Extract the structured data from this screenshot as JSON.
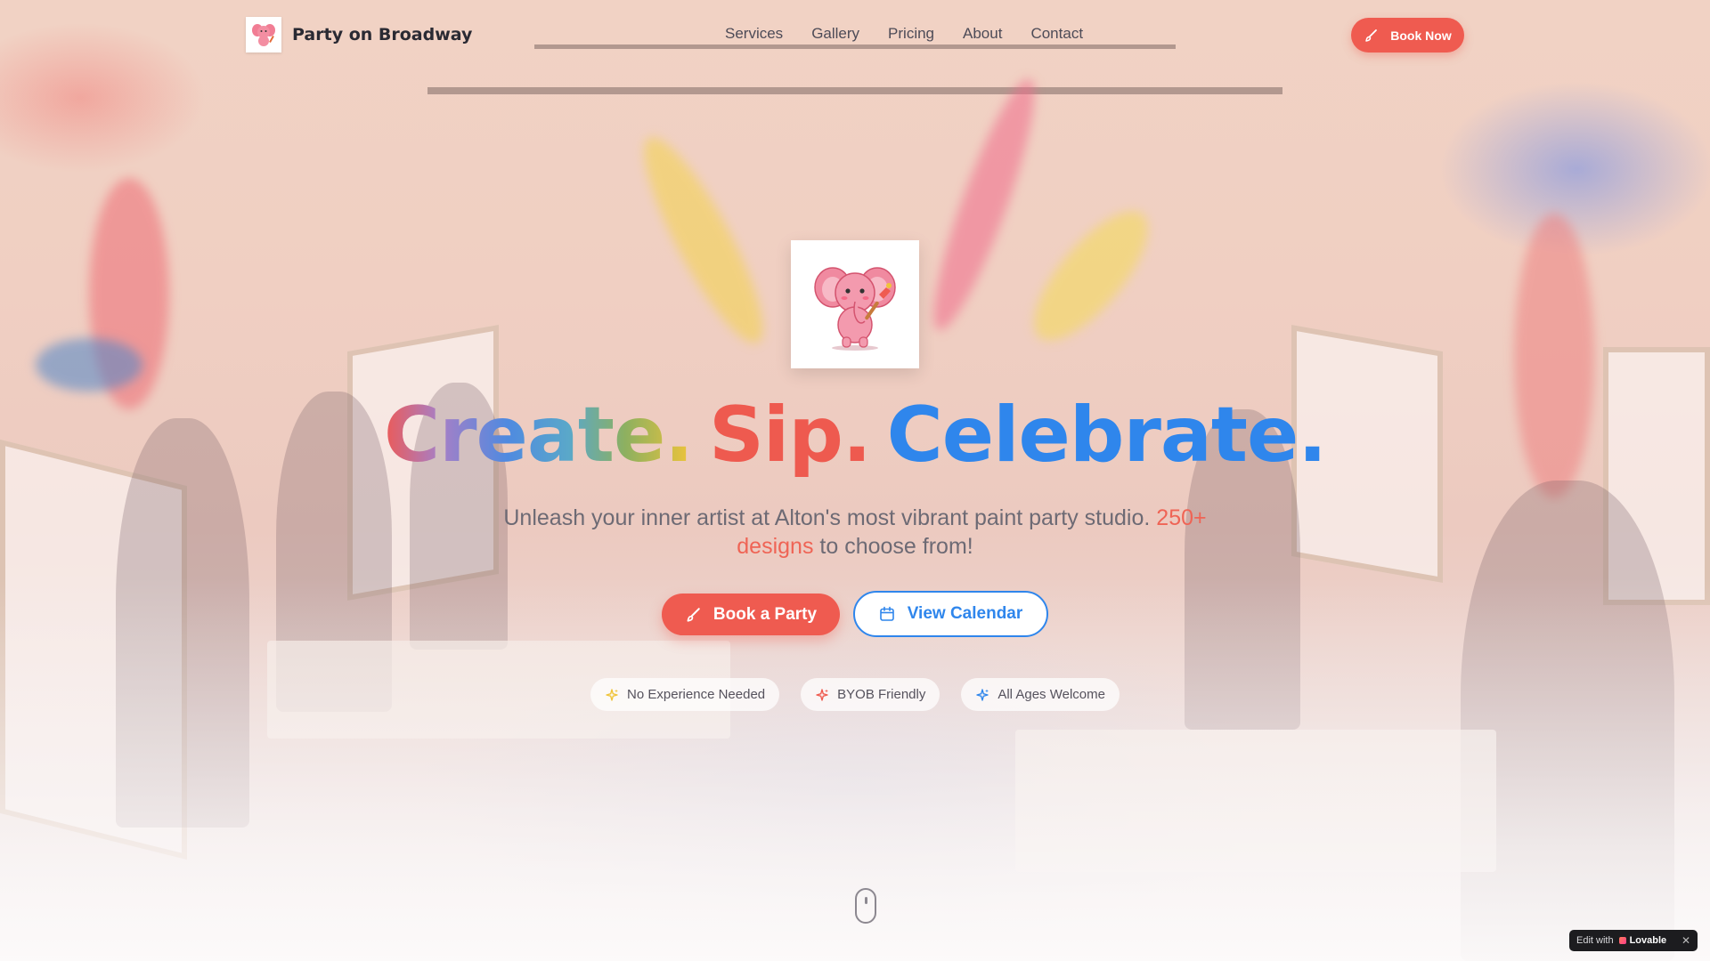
{
  "brand": {
    "name": "Party on Broadway",
    "logo_icon": "pink-elephant-painter-icon"
  },
  "nav": {
    "items": [
      {
        "label": "Services"
      },
      {
        "label": "Gallery"
      },
      {
        "label": "Pricing"
      },
      {
        "label": "About"
      },
      {
        "label": "Contact"
      }
    ]
  },
  "header": {
    "cta_label": "Book Now",
    "cta_icon": "paintbrush-icon"
  },
  "hero": {
    "headline": {
      "word1": "Create.",
      "word2": "Sip.",
      "word3": "Celebrate."
    },
    "subtitle": {
      "lead": "Unleash your inner artist at Alton's most vibrant paint party studio.",
      "accent": "250+ designs",
      "tail": "to choose from!"
    },
    "primary_cta": "Book a Party",
    "secondary_cta": "View Calendar",
    "badges": [
      {
        "label": "No Experience Needed",
        "icon": "sparkles-icon",
        "color": "#f0c43a"
      },
      {
        "label": "BYOB Friendly",
        "icon": "sparkles-icon",
        "color": "#ef5b50"
      },
      {
        "label": "All Ages Welcome",
        "icon": "sparkles-icon",
        "color": "#2f86ec"
      }
    ]
  },
  "footer_widget": {
    "prefix": "Edit with",
    "brand": "Lovable"
  },
  "colors": {
    "primary": "#ef5b50",
    "secondary": "#2f86ec",
    "accent_yellow": "#f0c43a",
    "text": "#2a2a33"
  }
}
